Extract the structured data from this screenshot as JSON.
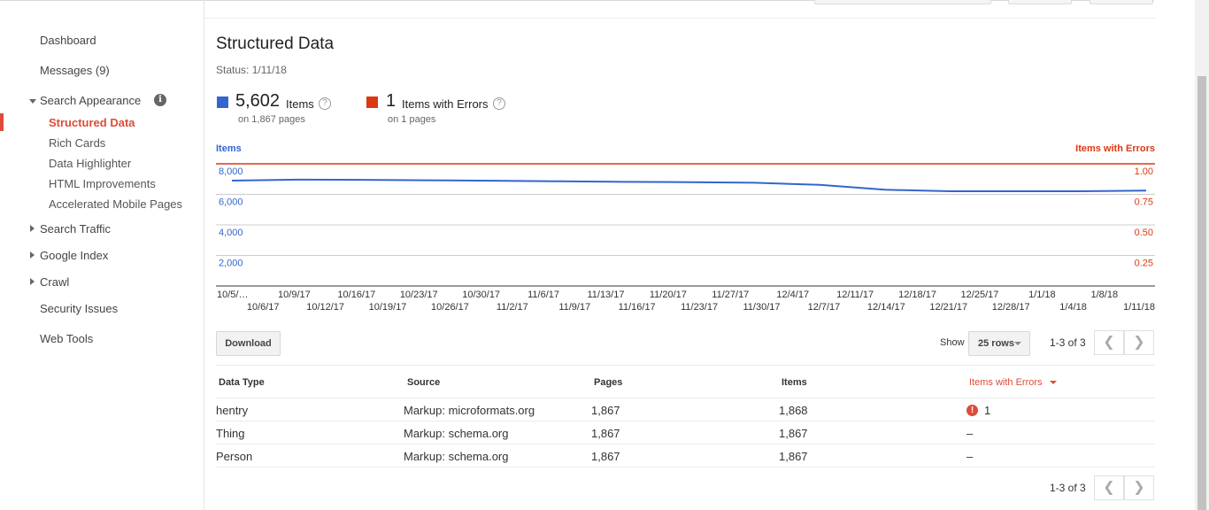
{
  "sidebar": {
    "dashboard": "Dashboard",
    "messages": "Messages (9)",
    "search_appearance": "Search Appearance",
    "search_appearance_sub": [
      "Structured Data",
      "Rich Cards",
      "Data Highlighter",
      "HTML Improvements",
      "Accelerated Mobile Pages"
    ],
    "search_traffic": "Search Traffic",
    "google_index": "Google Index",
    "crawl": "Crawl",
    "security_issues": "Security Issues",
    "web_tools": "Web Tools"
  },
  "header": {
    "title": "Structured Data",
    "status": "Status: 1/11/18"
  },
  "metrics": {
    "items": {
      "value": "5,602",
      "label": "Items",
      "sub": "on 1,867 pages",
      "color": "#3366cc"
    },
    "errors": {
      "value": "1",
      "label": "Items with Errors",
      "sub": "on 1 pages",
      "color": "#dc3912"
    }
  },
  "chart_data": {
    "type": "line",
    "left_axis_label": "Items",
    "right_axis_label": "Items with Errors",
    "left_ticks": [
      "8,000",
      "6,000",
      "4,000",
      "2,000"
    ],
    "right_ticks": [
      "1.00",
      "0.75",
      "0.50",
      "0.25"
    ],
    "left_ylim": [
      0,
      8000
    ],
    "right_ylim": [
      0,
      1
    ],
    "grid": true,
    "x_labels_top": [
      "10/5/…",
      "10/9/17",
      "10/16/17",
      "10/23/17",
      "10/30/17",
      "11/6/17",
      "11/13/17",
      "11/20/17",
      "11/27/17",
      "12/4/17",
      "12/11/17",
      "12/18/17",
      "12/25/17",
      "1/1/18",
      "1/8/18"
    ],
    "x_labels_bottom": [
      "10/6/17",
      "10/12/17",
      "10/19/17",
      "10/26/17",
      "11/2/17",
      "11/9/17",
      "11/16/17",
      "11/23/17",
      "11/30/17",
      "12/7/17",
      "12/14/17",
      "12/21/17",
      "12/28/17",
      "1/4/18",
      "1/11/18"
    ],
    "series": [
      {
        "name": "Items",
        "color": "#3366cc",
        "axis": "left",
        "x": [
          "10/5/17",
          "10/12/17",
          "10/19/17",
          "10/26/17",
          "11/2/17",
          "11/9/17",
          "11/16/17",
          "11/23/17",
          "11/30/17",
          "12/7/17",
          "12/14/17",
          "12/21/17",
          "12/28/17",
          "1/4/18",
          "1/11/18"
        ],
        "values": [
          6900,
          6960,
          6950,
          6920,
          6890,
          6860,
          6820,
          6800,
          6760,
          6620,
          6300,
          6200,
          6200,
          6200,
          6250
        ]
      },
      {
        "name": "Items with Errors",
        "color": "#dc3912",
        "axis": "right",
        "x": [
          "10/5/17",
          "1/11/18"
        ],
        "values": [
          1,
          1
        ]
      }
    ]
  },
  "toolbar": {
    "download": "Download",
    "show_label": "Show",
    "rows_select": "25 rows",
    "range_top": "1-3 of 3",
    "range_bottom": "1-3 of 3"
  },
  "table": {
    "columns": [
      "Data Type",
      "Source",
      "Pages",
      "Items",
      "Items with Errors"
    ],
    "rows": [
      [
        "hentry",
        "Markup: microformats.org",
        "1,867",
        "1,868",
        "1"
      ],
      [
        "Thing",
        "Markup: schema.org",
        "1,867",
        "1,867",
        "–"
      ],
      [
        "Person",
        "Markup: schema.org",
        "1,867",
        "1,867",
        "–"
      ]
    ]
  }
}
